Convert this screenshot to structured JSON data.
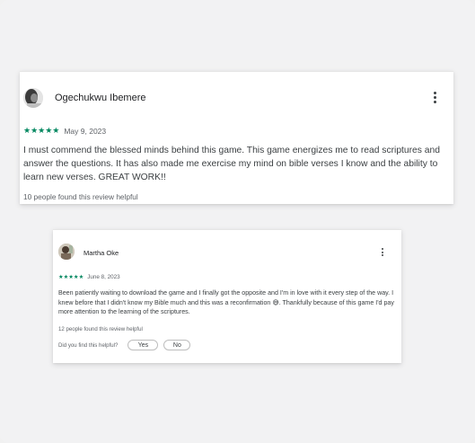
{
  "reviews": [
    {
      "reviewer": "Ogechukwu Ibemere",
      "stars": "★★★★★",
      "rating": 5,
      "date": "May 9, 2023",
      "text": "I must commend the blessed minds behind this game. This game energizes me to read scriptures and answer the questions. It has also made me exercise my mind on bible verses I know and the ability to learn new verses. GREAT WORK!!",
      "helpful": "10 people found this review helpful"
    },
    {
      "reviewer": "Martha Oke",
      "stars": "★★★★★",
      "rating": 5,
      "date": "June 8, 2023",
      "text": "Been patiently waiting to download the game and I finally got the opposite and I'm in love with it every step of the way. I knew before that I didn't know my Bible much and this was a reconfirmation 😅. Thankfully because of this game I'd pay more attention to the learning of the scriptures.",
      "helpful": "12 people found this review helpful",
      "helpful_question": "Did you find this helpful?",
      "yes_label": "Yes",
      "no_label": "No"
    }
  ],
  "colors": {
    "star": "#01875f",
    "background": "#f2f2f3",
    "card": "#ffffff",
    "text": "#3c4043"
  },
  "icons": {
    "more": "more-vert-icon",
    "star": "star-icon",
    "avatar": "avatar"
  }
}
